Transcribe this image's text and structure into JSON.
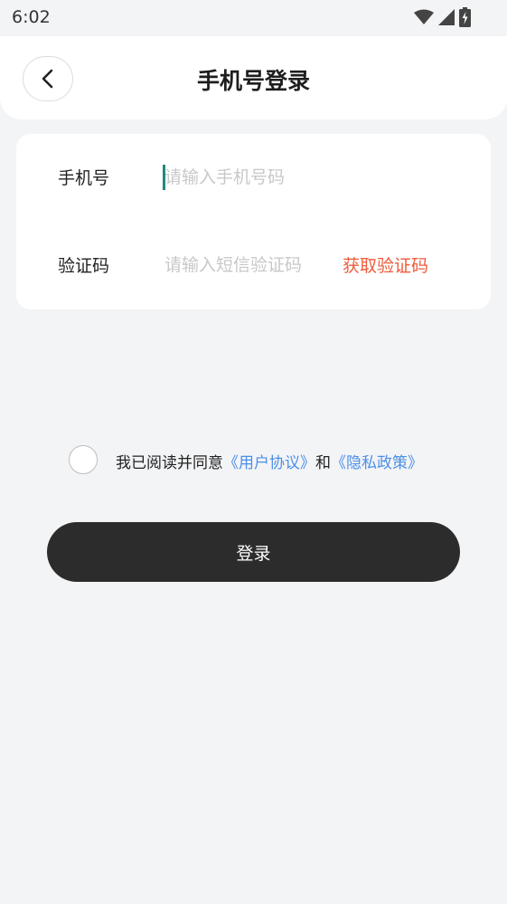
{
  "status_bar": {
    "time": "6:02",
    "icons": [
      "wifi-icon",
      "signal-icon",
      "battery-charging-icon"
    ]
  },
  "header": {
    "title": "手机号登录",
    "back_icon": "chevron-left-icon"
  },
  "form": {
    "phone": {
      "label": "手机号",
      "value": "",
      "placeholder": "请输入手机号码"
    },
    "code": {
      "label": "验证码",
      "value": "",
      "placeholder": "请输入短信验证码",
      "get_code_label": "获取验证码"
    }
  },
  "agreement": {
    "checked": false,
    "prefix": "我已阅读并同意",
    "user_agreement": "《用户协议》",
    "conjunction": "和",
    "privacy_policy": "《隐私政策》"
  },
  "login_button_label": "登录",
  "colors": {
    "background": "#f3f4f6",
    "accent_link": "#4b8fe8",
    "get_code": "#ee5b3b",
    "button": "#2c2c2c",
    "caret": "#1e8a7a"
  }
}
